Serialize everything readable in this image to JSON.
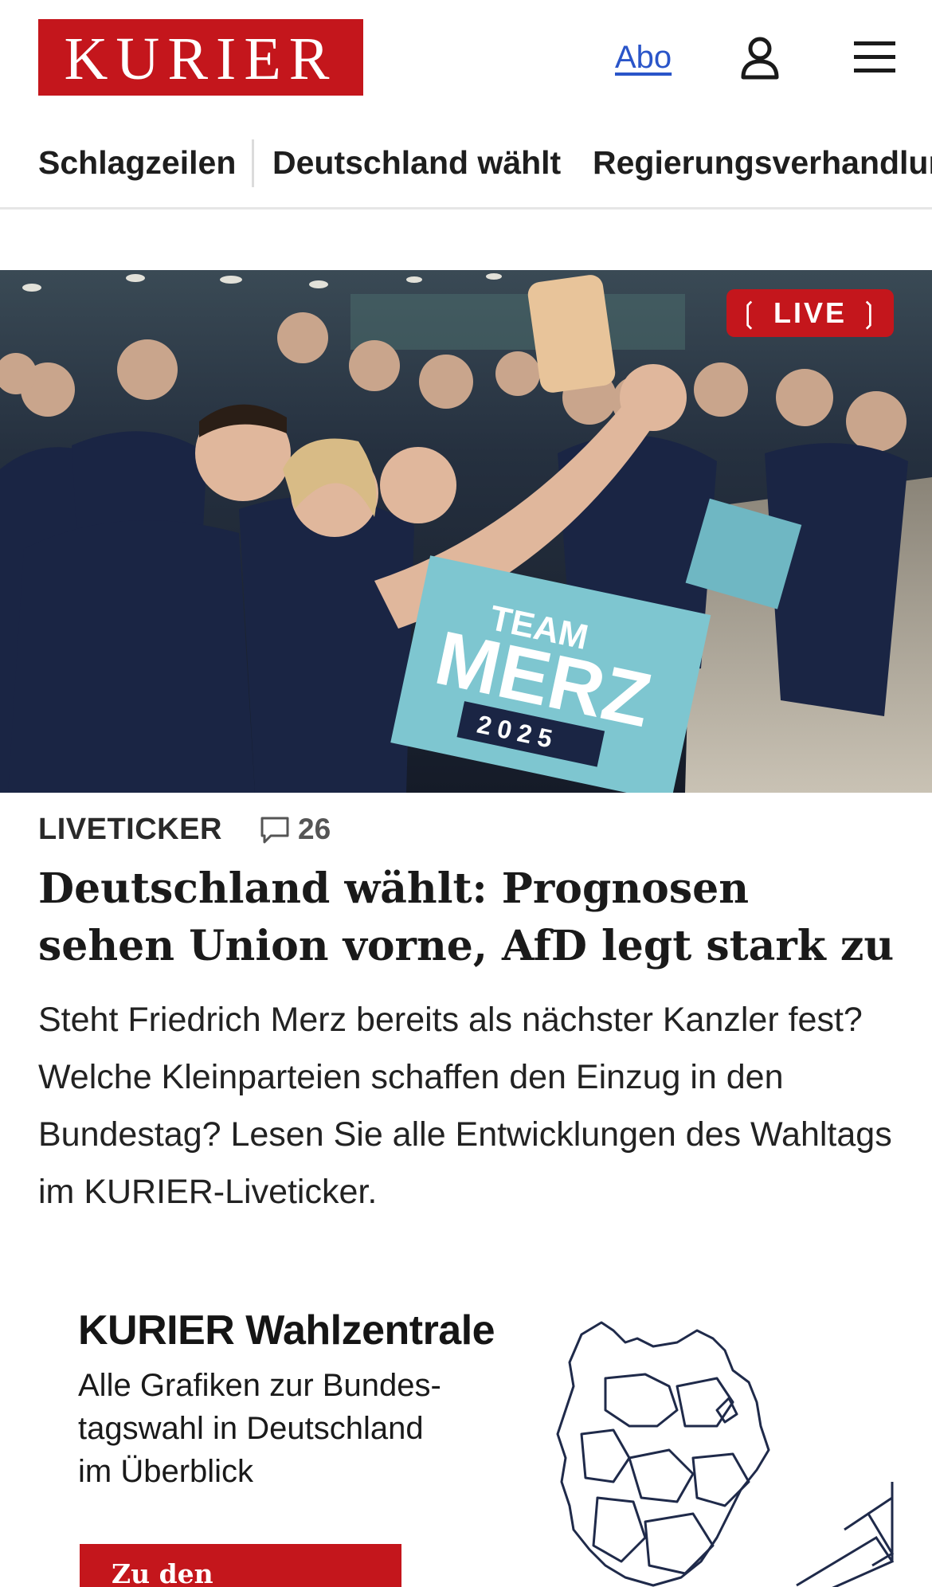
{
  "header": {
    "logo_text": "KURIER",
    "abo_label": "Abo",
    "user_icon": "user-icon",
    "menu_icon": "hamburger-menu-icon",
    "brand_color": "#c4161c"
  },
  "nav": {
    "items": [
      "Schlagzeilen",
      "Deutschland wählt",
      "Regierungsverhandlungen"
    ]
  },
  "hero": {
    "image_alt": "",
    "live_badge": "LIVE",
    "sign_team": "TEAM",
    "sign_merz": "MERZ",
    "sign_year": "2025"
  },
  "article": {
    "kicker": "LIVETICKER",
    "comment_icon": "comment-icon",
    "comment_count": "26",
    "headline": "Deutschland wählt: Prognosen sehen Union vorne, AfD legt stark zu",
    "teaser": "Steht Friedrich Merz bereits als nächster Kanzler fest? Welche Kleinparteien schaffen den Einzug in den Bundestag? Lesen Sie alle Entwicklungen des Wahltags im KURIER-Liveticker."
  },
  "promo": {
    "title": "KURIER Wahlzentrale",
    "text_lines": [
      "Alle Grafiken zur Bundes-",
      "tagswahl in Deutschland",
      "im Überblick"
    ],
    "button_label": "Zu den Ergebnissen"
  }
}
